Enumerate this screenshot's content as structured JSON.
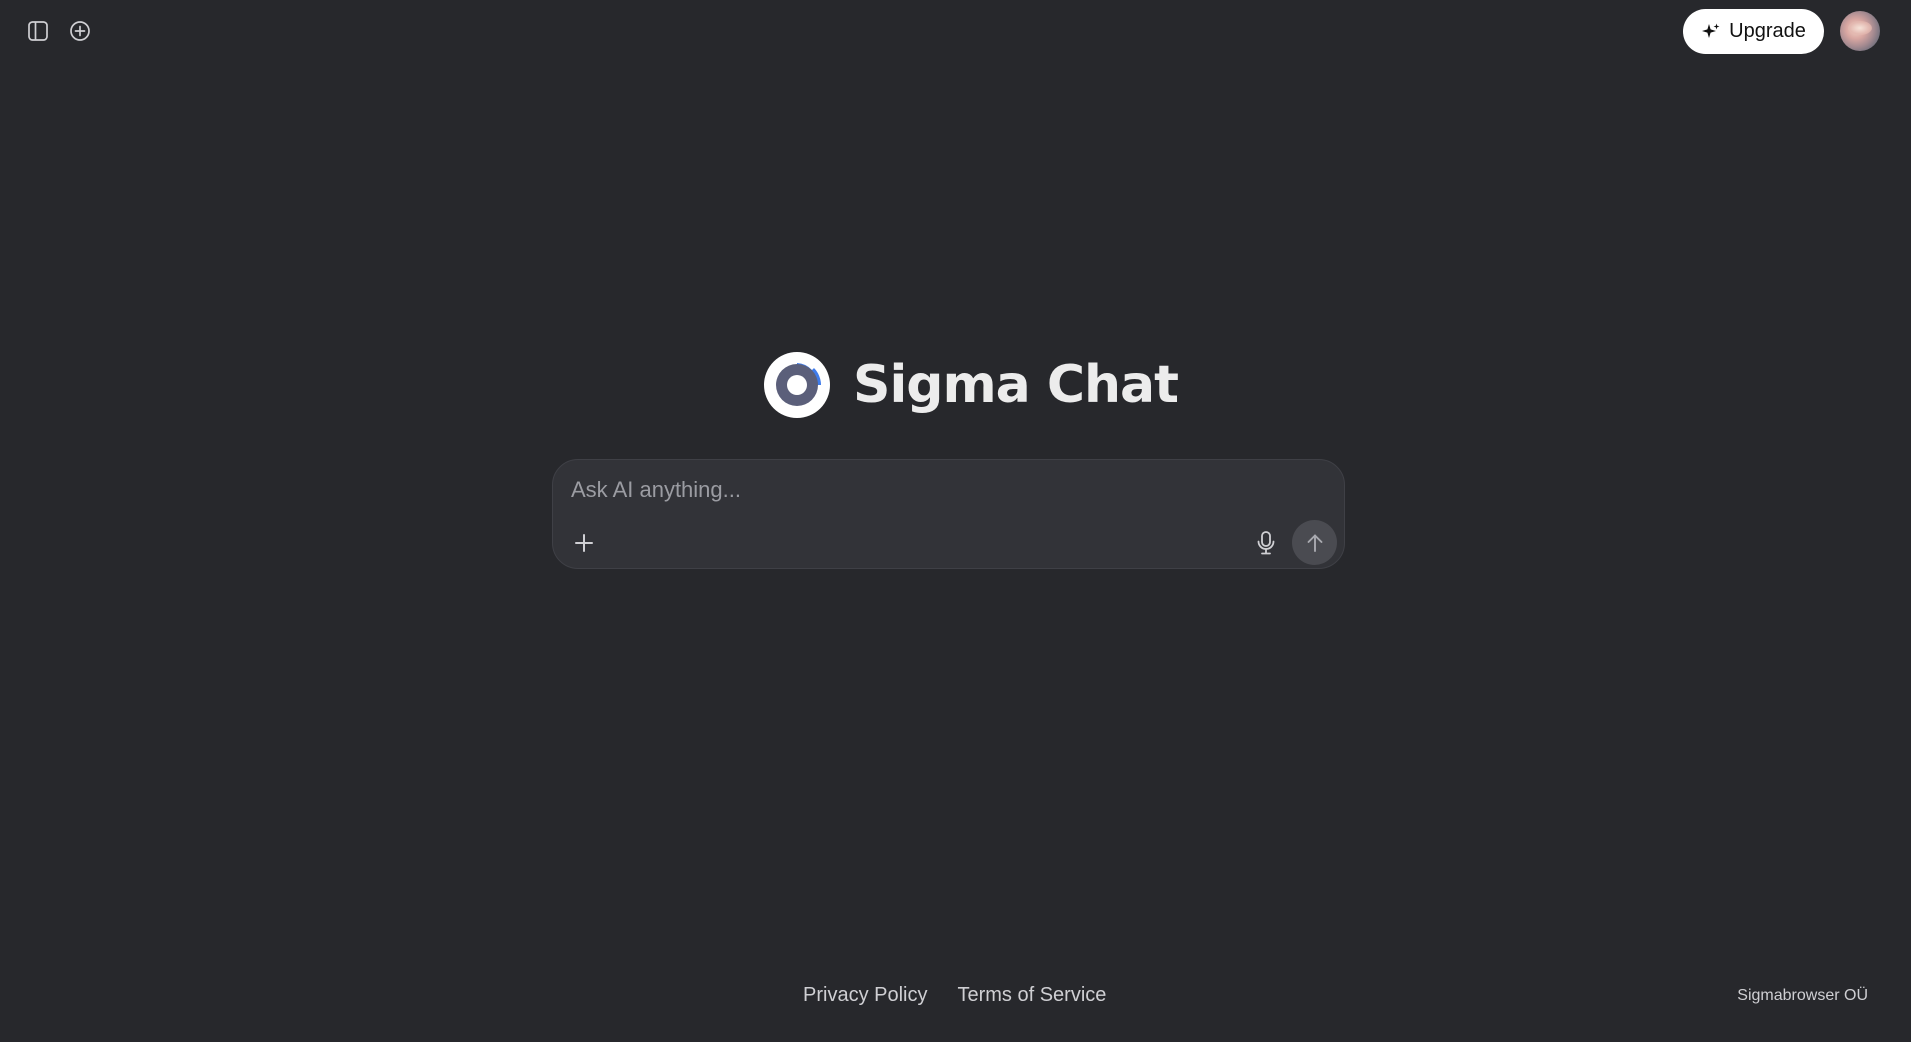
{
  "header": {
    "sidebar_toggle_icon": "sidebar-panel-icon",
    "new_chat_icon": "plus-circle-icon",
    "upgrade_label": "Upgrade",
    "upgrade_icon": "sparkle-icon",
    "avatar_icon": "user-avatar"
  },
  "brand": {
    "title": "Sigma Chat",
    "logo_colors": [
      "#ffffff",
      "#5b5f7a",
      "#3f7bea"
    ]
  },
  "chat": {
    "placeholder": "Ask AI anything...",
    "value": "",
    "attach_icon": "plus-icon",
    "mic_icon": "microphone-icon",
    "send_icon": "arrow-up-icon"
  },
  "footer": {
    "privacy_label": "Privacy Policy",
    "terms_label": "Terms of Service",
    "company": "Sigmabrowser OÜ"
  },
  "colors": {
    "background": "#27282c",
    "input_background": "#323338",
    "upgrade_background": "#ffffff",
    "send_button": "#4a4b51",
    "accent": "#3f7bea"
  }
}
